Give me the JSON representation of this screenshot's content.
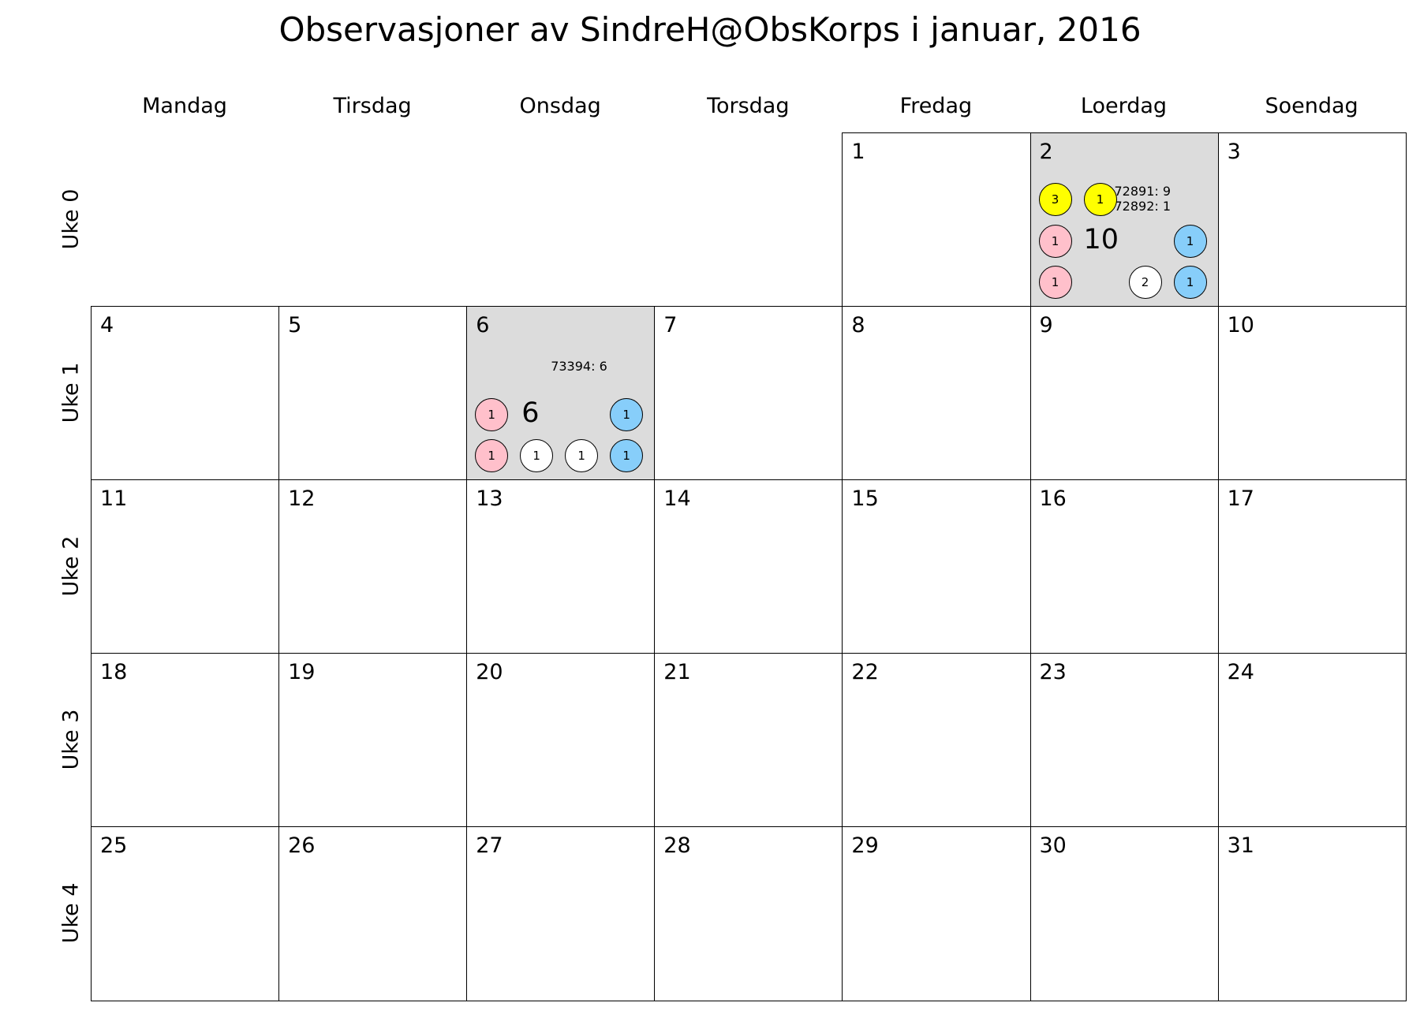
{
  "chart_data": {
    "type": "table",
    "title": "Observasjoner av SindreH@ObsKorps i januar, 2016",
    "weekdays": [
      "Mandag",
      "Tirsdag",
      "Onsdag",
      "Torsdag",
      "Fredag",
      "Loerdag",
      "Soendag"
    ],
    "weeks": [
      "Uke 0",
      "Uke 1",
      "Uke 2",
      "Uke 3",
      "Uke 4"
    ],
    "days": [
      {
        "day": "1",
        "week": 0,
        "weekday": 4
      },
      {
        "day": "2",
        "week": 0,
        "weekday": 5,
        "shaded": true,
        "total": "10",
        "notes": [
          "72891: 9",
          "72892: 1"
        ],
        "markers": [
          {
            "value": "3",
            "color": "#ffff00",
            "slot": "top-1"
          },
          {
            "value": "1",
            "color": "#ffff00",
            "slot": "top-2"
          },
          {
            "value": "1",
            "color": "#ffc0cb",
            "slot": "mid-left"
          },
          {
            "value": "1",
            "color": "#87cefa",
            "slot": "mid-right"
          },
          {
            "value": "1",
            "color": "#ffc0cb",
            "slot": "bot-1"
          },
          {
            "value": "2",
            "color": "#ffffff",
            "slot": "bot-3"
          },
          {
            "value": "1",
            "color": "#87cefa",
            "slot": "bot-4"
          }
        ]
      },
      {
        "day": "3",
        "week": 0,
        "weekday": 6
      },
      {
        "day": "4",
        "week": 1,
        "weekday": 0
      },
      {
        "day": "5",
        "week": 1,
        "weekday": 1
      },
      {
        "day": "6",
        "week": 1,
        "weekday": 2,
        "shaded": true,
        "total": "6",
        "notes": [
          "73394: 6"
        ],
        "markers": [
          {
            "value": "1",
            "color": "#ffc0cb",
            "slot": "mid-left"
          },
          {
            "value": "1",
            "color": "#87cefa",
            "slot": "mid-right"
          },
          {
            "value": "1",
            "color": "#ffc0cb",
            "slot": "bot-1"
          },
          {
            "value": "1",
            "color": "#ffffff",
            "slot": "bot-2"
          },
          {
            "value": "1",
            "color": "#ffffff",
            "slot": "bot-3"
          },
          {
            "value": "1",
            "color": "#87cefa",
            "slot": "bot-4"
          }
        ]
      },
      {
        "day": "7",
        "week": 1,
        "weekday": 3
      },
      {
        "day": "8",
        "week": 1,
        "weekday": 4
      },
      {
        "day": "9",
        "week": 1,
        "weekday": 5
      },
      {
        "day": "10",
        "week": 1,
        "weekday": 6
      },
      {
        "day": "11",
        "week": 2,
        "weekday": 0
      },
      {
        "day": "12",
        "week": 2,
        "weekday": 1
      },
      {
        "day": "13",
        "week": 2,
        "weekday": 2
      },
      {
        "day": "14",
        "week": 2,
        "weekday": 3
      },
      {
        "day": "15",
        "week": 2,
        "weekday": 4
      },
      {
        "day": "16",
        "week": 2,
        "weekday": 5
      },
      {
        "day": "17",
        "week": 2,
        "weekday": 6
      },
      {
        "day": "18",
        "week": 3,
        "weekday": 0
      },
      {
        "day": "19",
        "week": 3,
        "weekday": 1
      },
      {
        "day": "20",
        "week": 3,
        "weekday": 2
      },
      {
        "day": "21",
        "week": 3,
        "weekday": 3
      },
      {
        "day": "22",
        "week": 3,
        "weekday": 4
      },
      {
        "day": "23",
        "week": 3,
        "weekday": 5
      },
      {
        "day": "24",
        "week": 3,
        "weekday": 6
      },
      {
        "day": "25",
        "week": 4,
        "weekday": 0
      },
      {
        "day": "26",
        "week": 4,
        "weekday": 1
      },
      {
        "day": "27",
        "week": 4,
        "weekday": 2
      },
      {
        "day": "28",
        "week": 4,
        "weekday": 3
      },
      {
        "day": "29",
        "week": 4,
        "weekday": 4
      },
      {
        "day": "30",
        "week": 4,
        "weekday": 5
      },
      {
        "day": "31",
        "week": 4,
        "weekday": 6
      }
    ]
  }
}
